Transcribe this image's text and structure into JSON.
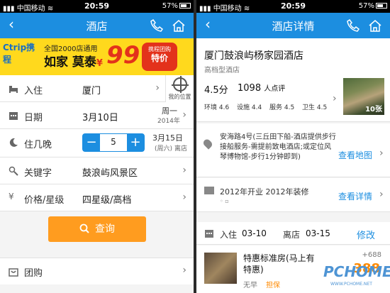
{
  "status_left": {
    "carrier": "中国移动"
  },
  "status_right": {
    "carrier": "中国移动"
  },
  "left": {
    "time": "20:59",
    "battery": "57%",
    "nav_title": "酒店",
    "banner": {
      "logo": "Ctrip携程",
      "line1": "全国2000店通用",
      "line2": "如家 莫泰",
      "yen": "¥",
      "price": "99",
      "badge_top": "携程团购",
      "badge_bottom": "特价"
    },
    "rows": {
      "checkin_label": "入住",
      "checkin_value": "厦门",
      "my_location": "我的位置",
      "date_label": "日期",
      "date_value": "3月10日",
      "date_weekday": "周一",
      "date_year": "2014年",
      "nights_label": "住几晚",
      "nights_value": "5",
      "checkout_date": "3月15日",
      "checkout_weekday": "(周六)",
      "checkout_label": "离店",
      "keyword_label": "关键字",
      "keyword_value": "鼓浪屿风景区",
      "price_label": "价格/星级",
      "price_value": "四星级/高档"
    },
    "search_button": "查询",
    "group_buy": "团购"
  },
  "right": {
    "time": "20:59",
    "battery": "57%",
    "nav_title": "酒店详情",
    "hotel": {
      "name": "厦门鼓浪屿杨家园酒店",
      "type": "高档型酒店",
      "score": "4.5分",
      "reviews": "1098",
      "reviews_unit": "人点评",
      "env": "环境 4.6",
      "facility": "设施 4.4",
      "service": "服务 4.5",
      "hygiene": "卫生 4.5",
      "photo_count": "10张"
    },
    "address": "安海路4号(三丘田下船-酒店提供步行接船服务-需提前致电酒店;或定位风琴博物馆-步行1分钟即到)",
    "view_map": "查看地图",
    "opening": "2012年开业 2012年装修",
    "view_details": "查看详情",
    "stay": {
      "checkin_label": "入住",
      "checkin": "03-10",
      "checkout_label": "离店",
      "checkout": "03-15",
      "modify": "修改"
    },
    "room": {
      "name": "特惠标准房(马上有特惠)",
      "no_breakfast": "无早",
      "guarantee": "担保",
      "price_old": "+688",
      "price": "388"
    },
    "watermark": "PCHOME",
    "watermark_url": "WWW.PCHOME.NET"
  }
}
